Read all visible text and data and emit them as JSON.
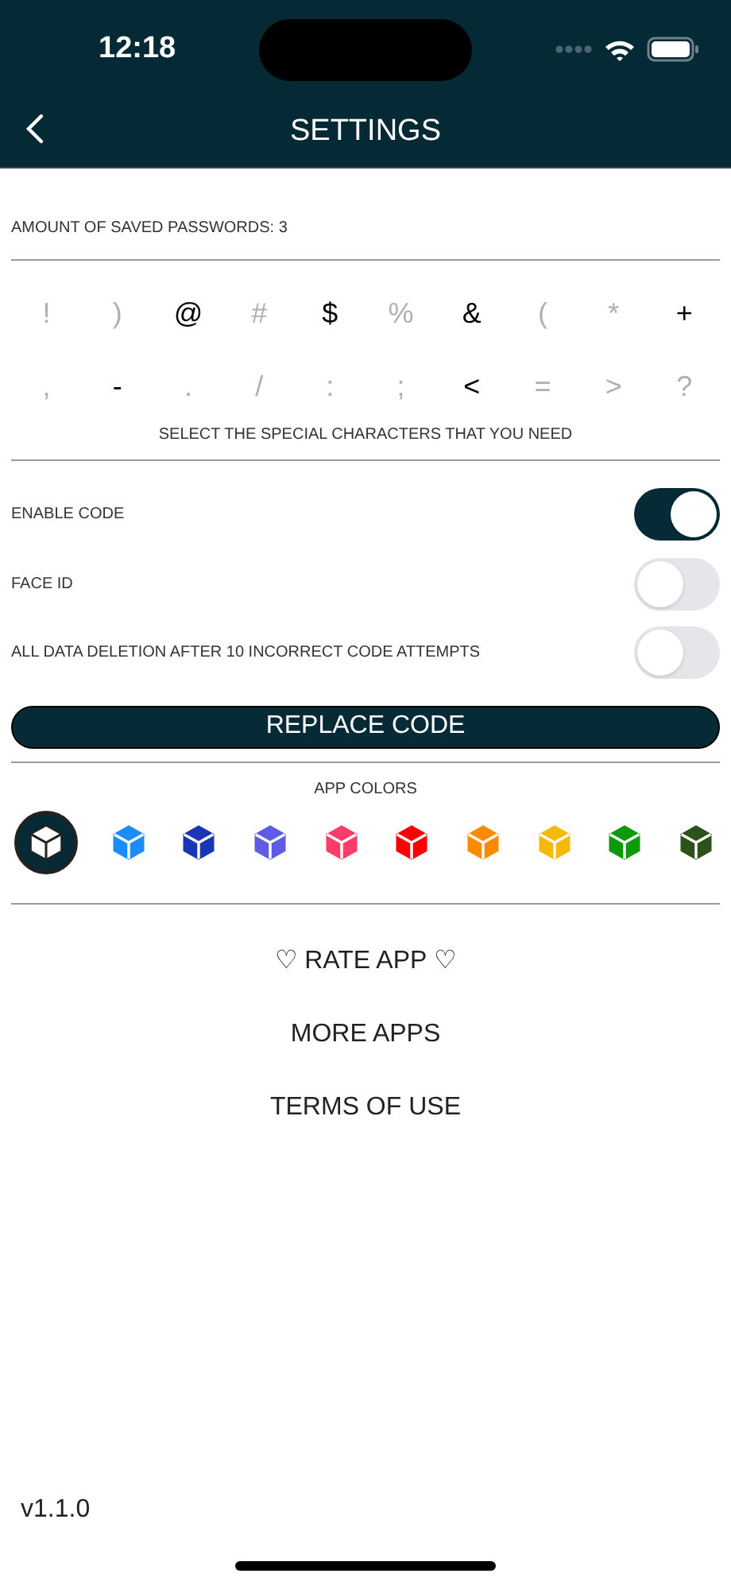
{
  "status_bar": {
    "time": "12:18"
  },
  "nav": {
    "title": "SETTINGS"
  },
  "saved_passwords": "AMOUNT OF SAVED PASSWORDS: 3",
  "special_characters": [
    {
      "char": "!",
      "selected": false
    },
    {
      "char": ")",
      "selected": false
    },
    {
      "char": "@",
      "selected": true
    },
    {
      "char": "#",
      "selected": false
    },
    {
      "char": "$",
      "selected": true
    },
    {
      "char": "%",
      "selected": false
    },
    {
      "char": "&",
      "selected": true
    },
    {
      "char": "(",
      "selected": false
    },
    {
      "char": "*",
      "selected": false
    },
    {
      "char": "+",
      "selected": true
    },
    {
      "char": ",",
      "selected": false
    },
    {
      "char": "-",
      "selected": true
    },
    {
      "char": ".",
      "selected": false
    },
    {
      "char": "/",
      "selected": false
    },
    {
      "char": ":",
      "selected": false
    },
    {
      "char": ";",
      "selected": false
    },
    {
      "char": "<",
      "selected": true
    },
    {
      "char": "=",
      "selected": false
    },
    {
      "char": ">",
      "selected": false
    },
    {
      "char": "?",
      "selected": false
    }
  ],
  "special_characters_hint": "SELECT THE SPECIAL CHARACTERS THAT YOU NEED",
  "toggles": [
    {
      "label": "ENABLE CODE",
      "on": true
    },
    {
      "label": "FACE ID",
      "on": false
    },
    {
      "label": "ALL DATA DELETION AFTER 10 INCORRECT CODE ATTEMPTS",
      "on": false
    }
  ],
  "replace_button": "REPLACE CODE",
  "app_colors": {
    "title": "APP COLORS",
    "colors": [
      {
        "color": "#062a36",
        "selected": true
      },
      {
        "color": "#1a8cff",
        "selected": false
      },
      {
        "color": "#1a36b5",
        "selected": false
      },
      {
        "color": "#5e5ce6",
        "selected": false
      },
      {
        "color": "#ff3b6a",
        "selected": false
      },
      {
        "color": "#ff0000",
        "selected": false
      },
      {
        "color": "#ff8a00",
        "selected": false
      },
      {
        "color": "#f5b90a",
        "selected": false
      },
      {
        "color": "#0a9a0a",
        "selected": false
      },
      {
        "color": "#2b5218",
        "selected": false
      }
    ]
  },
  "links": [
    "♡ RATE APP ♡",
    "MORE APPS",
    "TERMS OF USE"
  ],
  "version": "v1.1.0"
}
